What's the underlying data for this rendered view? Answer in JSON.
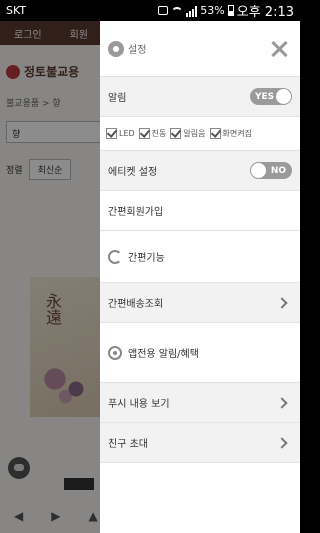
{
  "status_bar": {
    "carrier": "SKT",
    "battery": "53%",
    "time": "오후 2:13"
  },
  "background": {
    "top_menu": [
      "로그인",
      "회원"
    ],
    "logo": "정토불교용",
    "breadcrumb": "불교용품 > 향",
    "category_select": "향",
    "sort_label": "정렬",
    "sort_value": "최신순",
    "product_chars": "永遠"
  },
  "drawer": {
    "title": "설정",
    "notifications": {
      "label": "알림",
      "toggle_text": "YES"
    },
    "options": [
      {
        "label": "LED",
        "checked": true
      },
      {
        "label": "진동",
        "checked": true
      },
      {
        "label": "알림음",
        "checked": true
      },
      {
        "label": "화면켜짐",
        "checked": true
      }
    ],
    "etiquette": {
      "label": "에티켓 설정",
      "toggle_text": "NO"
    },
    "simple_join": "간편회원가입",
    "simple_functions": "간편기능",
    "shipping_lookup": "간편배송조회",
    "app_alerts": "앱전용 알림/혜택",
    "push_view": "푸시 내용 보기",
    "invite": "친구 초대"
  }
}
